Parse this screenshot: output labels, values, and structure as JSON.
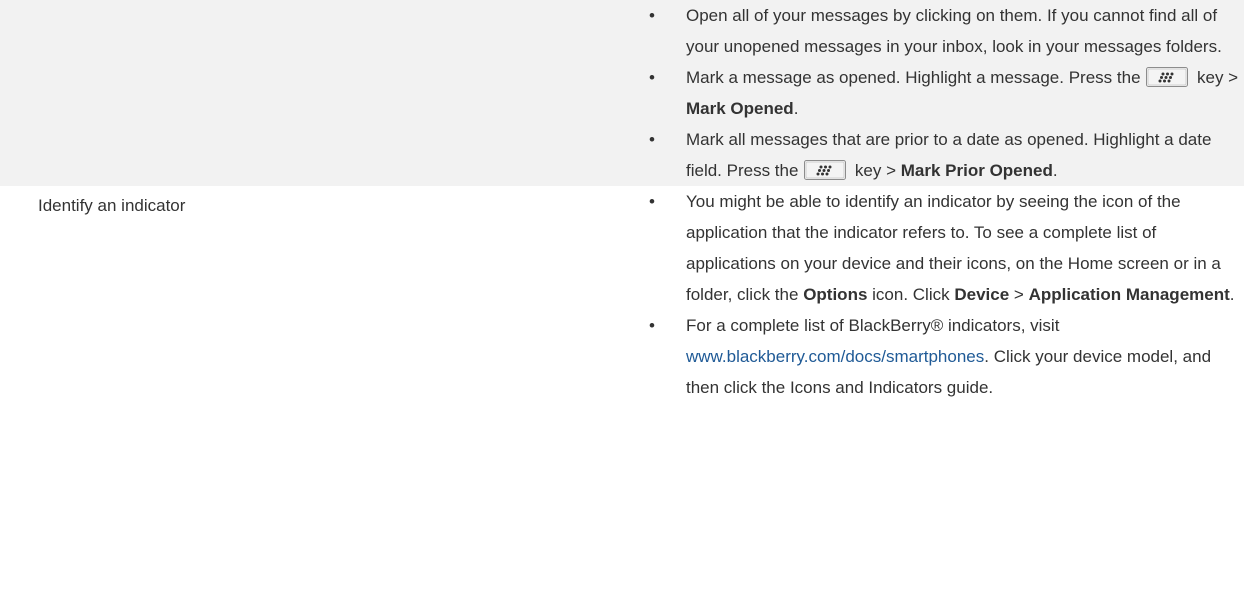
{
  "rows": [
    {
      "label": "",
      "bullets": [
        {
          "text": "Open all of your messages by clicking on them. If you cannot find all of your unopened messages in your inbox, look in your messages folders."
        },
        {
          "text_before_key": "Mark a message as opened. Highlight a message. Press the",
          "text_after_key": "key >",
          "bold": "Mark Opened",
          "tail": "."
        },
        {
          "text_before_key": "Mark all messages that are prior to a date as opened. Highlight a date field. Press the",
          "text_after_key": "key >",
          "bold": "Mark Prior Opened",
          "tail": "."
        }
      ]
    },
    {
      "label": "Identify an indicator",
      "bullets": [
        {
          "part1": "You might be able to identify an indicator by seeing the icon of the application that the indicator refers to. To see a complete list of applications on your device and their icons, on the Home screen or in a folder, click the",
          "bold1": "Options",
          "part2": "icon. Click",
          "bold2": "Device",
          "part3": ">",
          "bold3": "Application Management",
          "tail": "."
        },
        {
          "part1": "For a complete list of BlackBerry® indicators, visit",
          "link": "www.blackberry.com/docs/smartphones",
          "part2": ". Click your device model, and then click the Icons and Indicators guide."
        }
      ]
    }
  ],
  "icons": {
    "menu_key": "blackberry-menu-key-icon"
  },
  "colors": {
    "gray_row": "#f2f2f2",
    "link": "#1f5a96",
    "text": "#333333"
  }
}
